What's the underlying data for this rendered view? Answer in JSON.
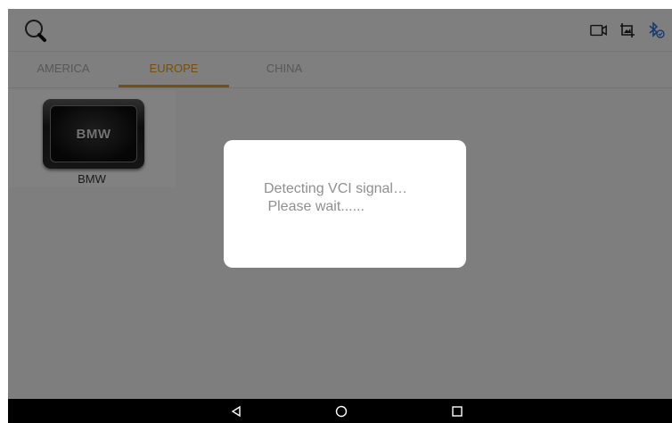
{
  "toolbar": {
    "search_icon": "search-icon",
    "icons": [
      "video-camera-icon",
      "screenshot-icon",
      "bluetooth-icon"
    ],
    "bluetooth_color": "#2f6fd6"
  },
  "tabs": [
    {
      "label": "AMERICA",
      "active": false
    },
    {
      "label": "EUROPE",
      "active": true
    },
    {
      "label": "CHINA",
      "active": false
    }
  ],
  "accent_color": "#e09a1a",
  "brands": [
    {
      "logo_text": "BMW",
      "label": "BMW"
    }
  ],
  "dialog": {
    "line1": "Detecting VCI signal…",
    "line2": " Please wait......"
  },
  "navbar": {
    "icons": [
      "back-icon",
      "home-icon",
      "recents-icon"
    ]
  }
}
